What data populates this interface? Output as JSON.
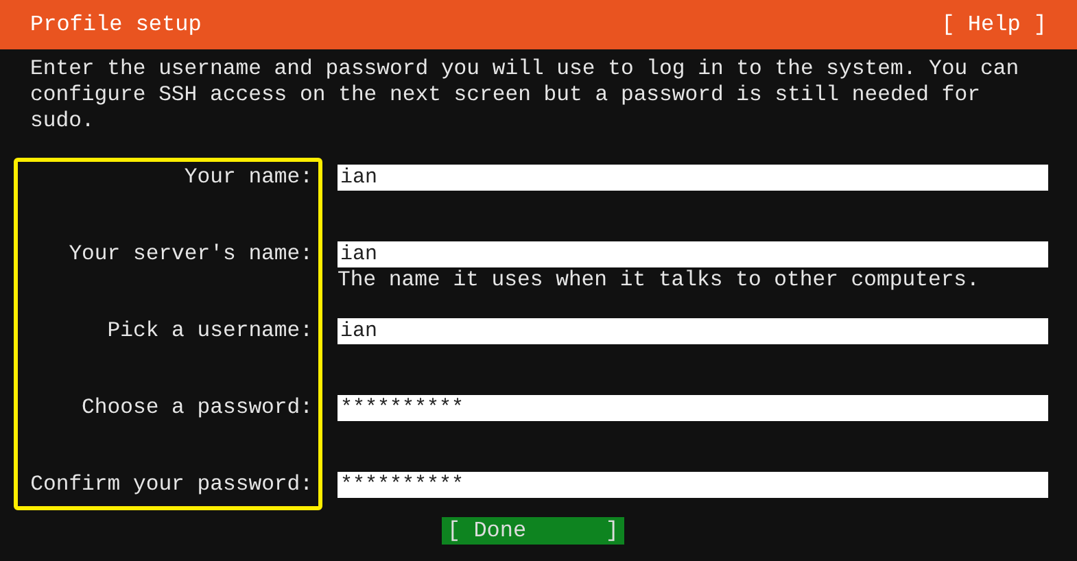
{
  "header": {
    "title": "Profile setup",
    "help": "[ Help ]"
  },
  "intro": "Enter the username and password you will use to log in to the system. You can configure SSH access on the next screen but a password is still needed for sudo.",
  "fields": [
    {
      "label": "Your name:",
      "value": "ian"
    },
    {
      "label": "Your server's name:",
      "value": "ian",
      "hint": "The name it uses when it talks to other computers."
    },
    {
      "label": "Pick a username:",
      "value": "ian"
    },
    {
      "label": "Choose a password:",
      "value": "**********"
    },
    {
      "label": "Confirm your password:",
      "value": "**********"
    }
  ],
  "highlight": {
    "color": "#ffee00"
  },
  "done_button": {
    "label": "[ Done",
    "bracket": "]"
  }
}
